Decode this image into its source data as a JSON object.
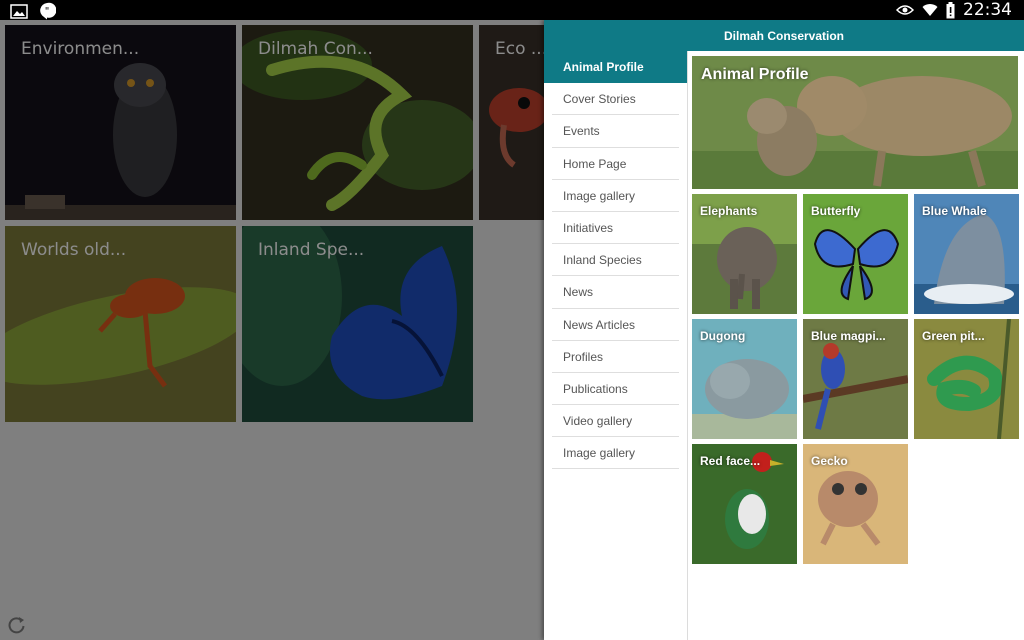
{
  "status_bar": {
    "time": "22:34"
  },
  "background": {
    "tiles": [
      {
        "label": "Environmen..."
      },
      {
        "label": "Dilmah Con..."
      },
      {
        "label": "Eco ..."
      },
      {
        "label": "Worlds old..."
      },
      {
        "label": "Inland Spe..."
      }
    ]
  },
  "drawer": {
    "title": "Dilmah Conservation",
    "menu": [
      {
        "label": "Animal Profile"
      },
      {
        "label": "Cover Stories"
      },
      {
        "label": "Events"
      },
      {
        "label": "Home Page"
      },
      {
        "label": "Image gallery"
      },
      {
        "label": "Initiatives"
      },
      {
        "label": "Inland Species"
      },
      {
        "label": "News"
      },
      {
        "label": "News Articles"
      },
      {
        "label": "Profiles"
      },
      {
        "label": "Publications"
      },
      {
        "label": "Video gallery"
      },
      {
        "label": "Image gallery"
      }
    ],
    "hero_title": "Animal Profile",
    "thumbs": [
      {
        "label": "Elephants"
      },
      {
        "label": "Butterfly"
      },
      {
        "label": "Blue Whale"
      },
      {
        "label": "Dugong"
      },
      {
        "label": "Blue magpi..."
      },
      {
        "label": "Green pit..."
      },
      {
        "label": "Red face..."
      },
      {
        "label": "Gecko"
      }
    ]
  }
}
